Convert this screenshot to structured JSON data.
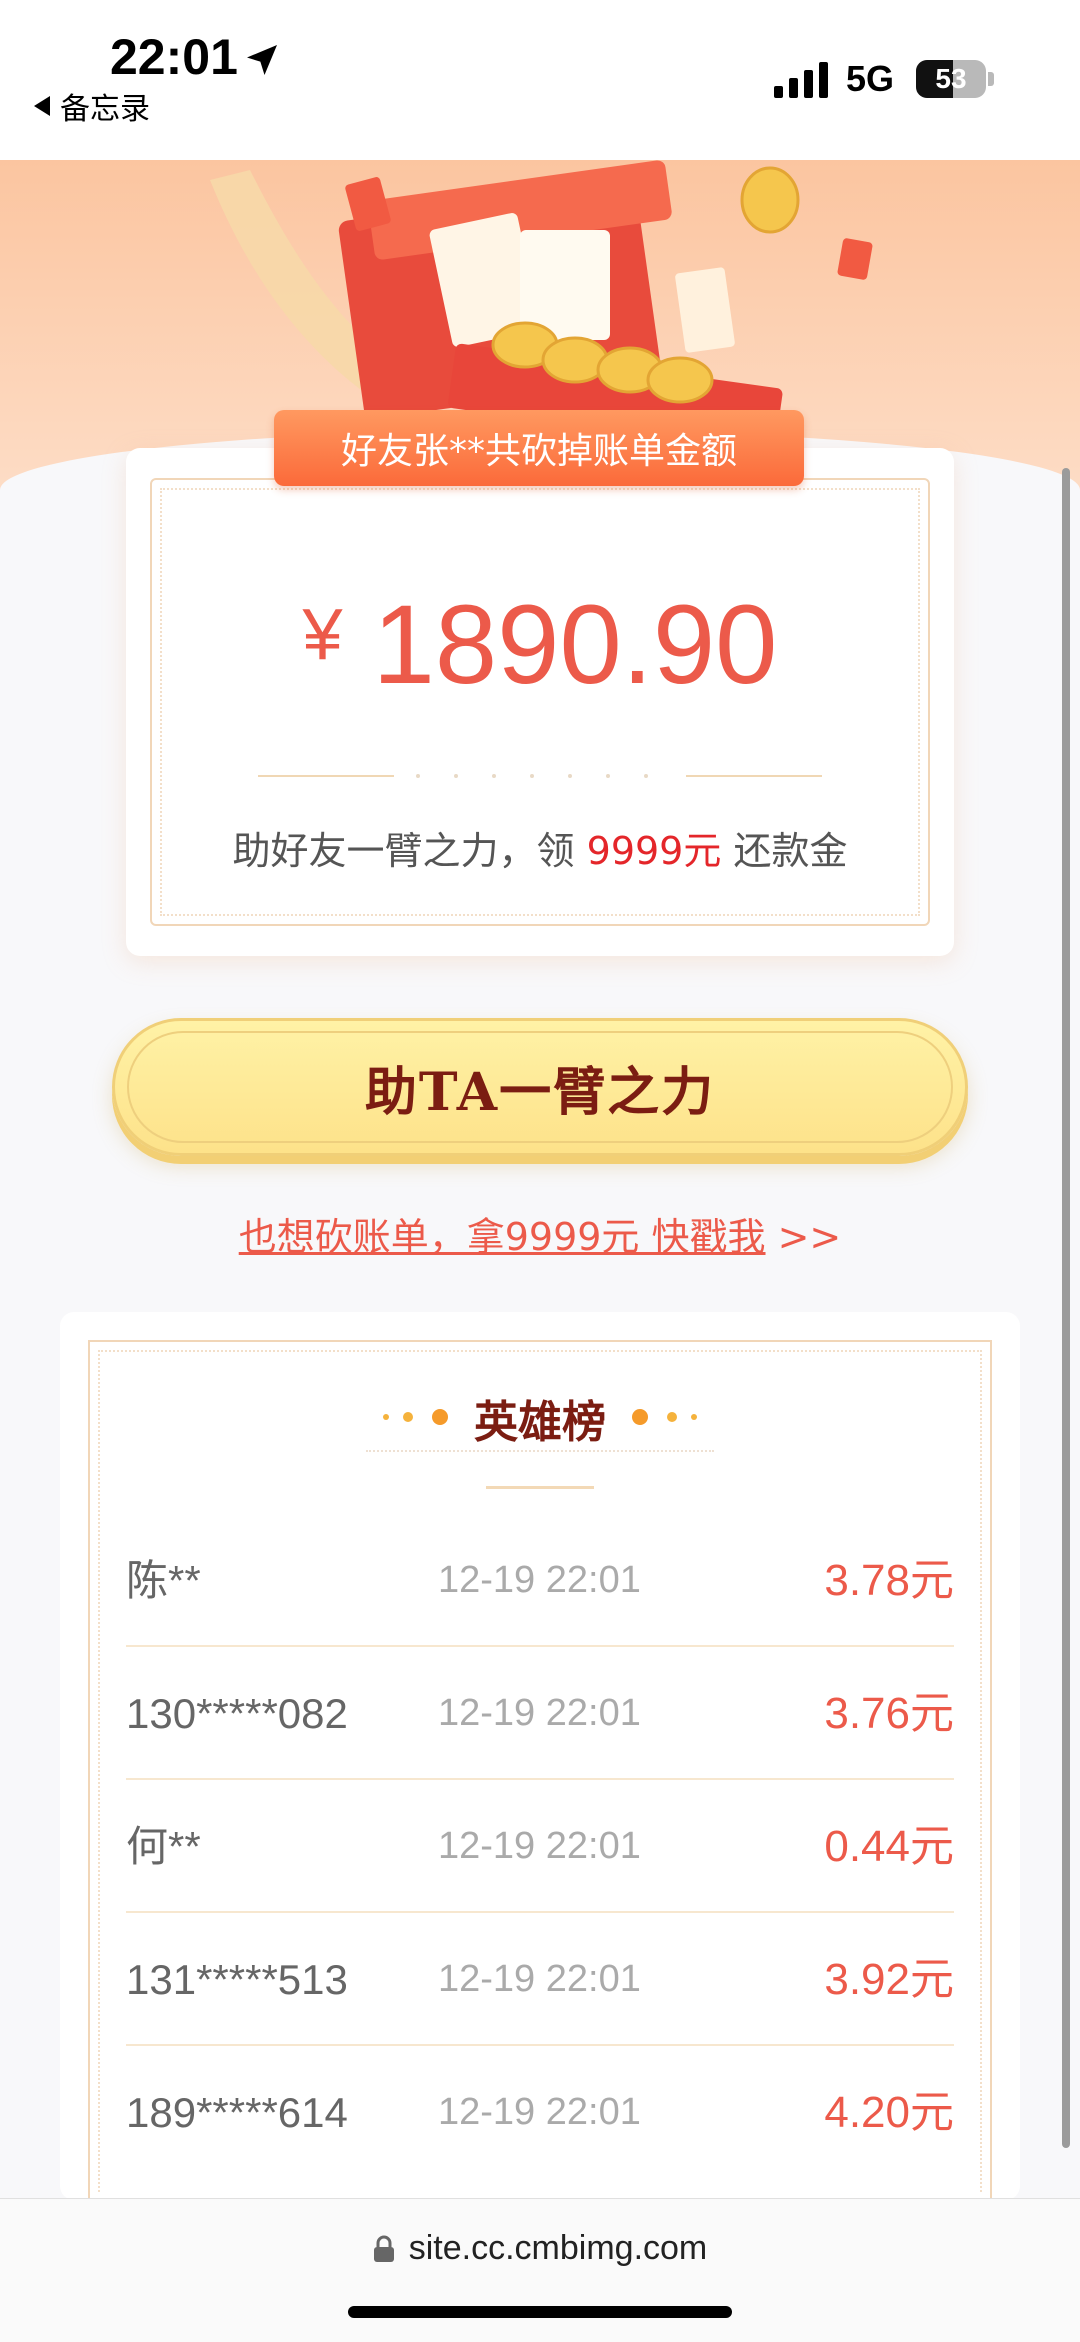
{
  "status_bar": {
    "time": "22:01",
    "back_app": "备忘录",
    "network": "5G",
    "battery": "53",
    "battery_level": 0.53
  },
  "card": {
    "ribbon_text": "好友张**共砍掉账单金额",
    "currency": "¥",
    "amount": "1890.90",
    "tip_prefix": "助好友一臂之力，领 ",
    "tip_highlight": "9999元",
    "tip_suffix": " 还款金"
  },
  "help_button": {
    "label": "助TA一臂之力"
  },
  "promo": {
    "link_text": "也想砍账单，拿9999元 快戳我",
    "arrow": " >>"
  },
  "leaderboard": {
    "title": "英雄榜",
    "rows": [
      {
        "name": "陈**",
        "time": "12-19 22:01",
        "amount": "3.78元"
      },
      {
        "name": "130*****082",
        "time": "12-19 22:01",
        "amount": "3.76元"
      },
      {
        "name": "何**",
        "time": "12-19 22:01",
        "amount": "0.44元"
      },
      {
        "name": "131*****513",
        "time": "12-19 22:01",
        "amount": "3.92元"
      },
      {
        "name": "189*****614",
        "time": "12-19 22:01",
        "amount": "4.20元"
      }
    ]
  },
  "browser": {
    "url": "site.cc.cmbimg.com"
  },
  "colors": {
    "accent_red": "#ec5a4a",
    "highlight_red": "#e4262a",
    "button_yellow": "#fde28a",
    "title_brown": "#7b1d12"
  },
  "icons": {
    "location": "location-arrow-icon",
    "signal": "signal-icon",
    "lock": "lock-icon",
    "back": "back-triangle-icon"
  }
}
